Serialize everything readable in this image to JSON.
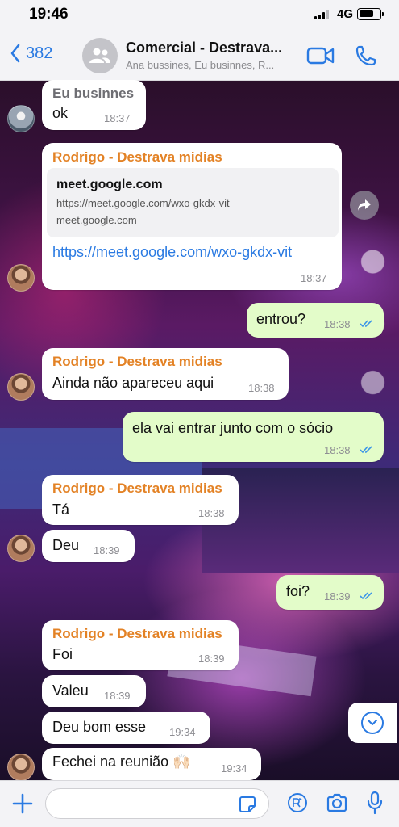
{
  "status_bar": {
    "time": "19:46",
    "network": "4G"
  },
  "header": {
    "back_count": "382",
    "title": "Comercial - Destrava...",
    "subtitle": "Ana bussines, Eu businnes, R..."
  },
  "colors": {
    "accent": "#2a7ae2",
    "sender": "#e38225",
    "outgoing": "#e3fcc9",
    "incoming": "#ffffff",
    "read_ticks": "#3b95e8"
  },
  "messages": [
    {
      "sender": "Eu businnes",
      "text": "ok",
      "time": "18:37"
    },
    {
      "sender": "Rodrigo - Destrava midias",
      "link_preview": {
        "title": "meet.google.com",
        "url": "https://meet.google.com/wxo-gkdx-vit",
        "domain": "meet.google.com"
      },
      "text": "https://meet.google.com/wxo-gkdx-vit",
      "time": "18:37"
    },
    {
      "text": "entrou?",
      "time": "18:38"
    },
    {
      "sender": "Rodrigo - Destrava midias",
      "text": "Ainda não apareceu aqui",
      "time": "18:38"
    },
    {
      "text": "ela vai entrar junto com o sócio",
      "time": "18:38"
    },
    {
      "sender": "Rodrigo - Destrava midias",
      "text": "Tá",
      "time": "18:38"
    },
    {
      "text": "Deu",
      "time": "18:39"
    },
    {
      "text": "foi?",
      "time": "18:39"
    },
    {
      "sender": "Rodrigo - Destrava midias",
      "text": "Foi",
      "time": "18:39"
    },
    {
      "text": "Valeu",
      "time": "18:39"
    },
    {
      "text": "Deu bom esse",
      "time": "19:34"
    },
    {
      "text": "Fechei na reunião 🙌🏻",
      "time": "19:34"
    }
  ],
  "icons": {
    "back": "chevron-left-icon",
    "group": "group-avatar-icon",
    "video": "video-camera-icon",
    "call": "phone-icon",
    "share": "share-icon",
    "scroll": "chevron-down-icon",
    "plus": "plus-icon",
    "sticker": "sticker-icon",
    "pix": "pix-icon",
    "camera": "camera-icon",
    "mic": "microphone-icon"
  }
}
